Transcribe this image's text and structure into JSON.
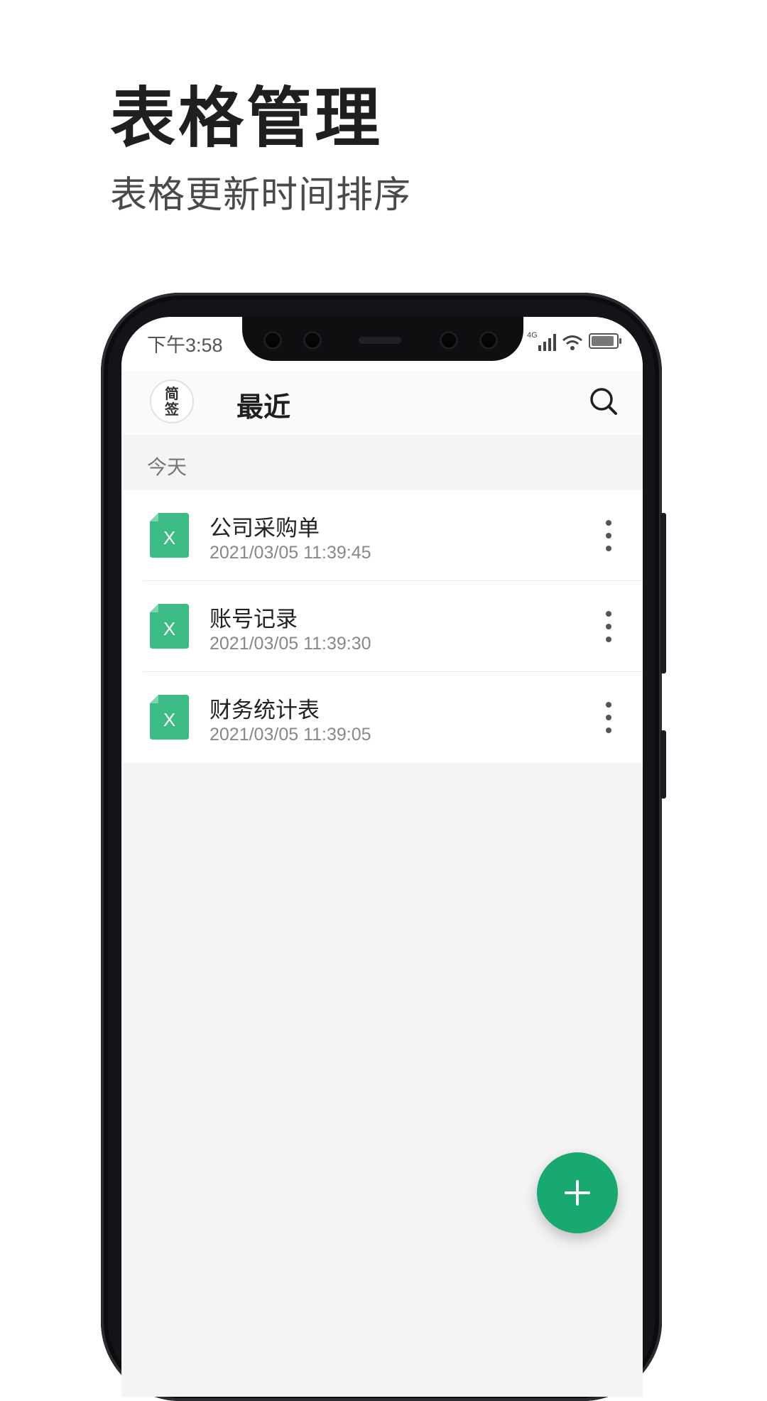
{
  "promo": {
    "title": "表格管理",
    "subtitle": "表格更新时间排序"
  },
  "status_bar": {
    "time": "下午3:58",
    "network_label": "4G",
    "battery_level": 0.9
  },
  "header": {
    "avatar_text": "简签",
    "title": "最近",
    "search_icon": "search-icon"
  },
  "section": {
    "label": "今天"
  },
  "files": [
    {
      "name": "公司采购单",
      "time": "2021/03/05 11:39:45",
      "icon": "excel-file-icon",
      "icon_letter": "X"
    },
    {
      "name": "账号记录",
      "time": "2021/03/05 11:39:30",
      "icon": "excel-file-icon",
      "icon_letter": "X"
    },
    {
      "name": "财务统计表",
      "time": "2021/03/05 11:39:05",
      "icon": "excel-file-icon",
      "icon_letter": "X"
    }
  ],
  "fab": {
    "icon": "plus-icon",
    "symbol": "+"
  },
  "colors": {
    "accent": "#17a96f",
    "file_icon": "#3dbb85",
    "file_icon_fold": "#7fd7ac",
    "background": "#f4f4f4"
  }
}
